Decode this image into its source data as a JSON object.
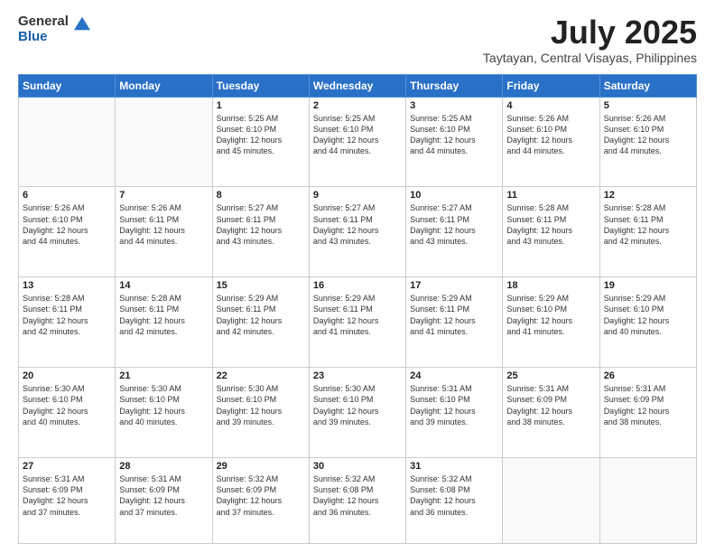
{
  "logo": {
    "general": "General",
    "blue": "Blue"
  },
  "header": {
    "month": "July 2025",
    "location": "Taytayan, Central Visayas, Philippines"
  },
  "weekdays": [
    "Sunday",
    "Monday",
    "Tuesday",
    "Wednesday",
    "Thursday",
    "Friday",
    "Saturday"
  ],
  "weeks": [
    [
      {
        "day": "",
        "info": ""
      },
      {
        "day": "",
        "info": ""
      },
      {
        "day": "1",
        "info": "Sunrise: 5:25 AM\nSunset: 6:10 PM\nDaylight: 12 hours\nand 45 minutes."
      },
      {
        "day": "2",
        "info": "Sunrise: 5:25 AM\nSunset: 6:10 PM\nDaylight: 12 hours\nand 44 minutes."
      },
      {
        "day": "3",
        "info": "Sunrise: 5:25 AM\nSunset: 6:10 PM\nDaylight: 12 hours\nand 44 minutes."
      },
      {
        "day": "4",
        "info": "Sunrise: 5:26 AM\nSunset: 6:10 PM\nDaylight: 12 hours\nand 44 minutes."
      },
      {
        "day": "5",
        "info": "Sunrise: 5:26 AM\nSunset: 6:10 PM\nDaylight: 12 hours\nand 44 minutes."
      }
    ],
    [
      {
        "day": "6",
        "info": "Sunrise: 5:26 AM\nSunset: 6:10 PM\nDaylight: 12 hours\nand 44 minutes."
      },
      {
        "day": "7",
        "info": "Sunrise: 5:26 AM\nSunset: 6:11 PM\nDaylight: 12 hours\nand 44 minutes."
      },
      {
        "day": "8",
        "info": "Sunrise: 5:27 AM\nSunset: 6:11 PM\nDaylight: 12 hours\nand 43 minutes."
      },
      {
        "day": "9",
        "info": "Sunrise: 5:27 AM\nSunset: 6:11 PM\nDaylight: 12 hours\nand 43 minutes."
      },
      {
        "day": "10",
        "info": "Sunrise: 5:27 AM\nSunset: 6:11 PM\nDaylight: 12 hours\nand 43 minutes."
      },
      {
        "day": "11",
        "info": "Sunrise: 5:28 AM\nSunset: 6:11 PM\nDaylight: 12 hours\nand 43 minutes."
      },
      {
        "day": "12",
        "info": "Sunrise: 5:28 AM\nSunset: 6:11 PM\nDaylight: 12 hours\nand 42 minutes."
      }
    ],
    [
      {
        "day": "13",
        "info": "Sunrise: 5:28 AM\nSunset: 6:11 PM\nDaylight: 12 hours\nand 42 minutes."
      },
      {
        "day": "14",
        "info": "Sunrise: 5:28 AM\nSunset: 6:11 PM\nDaylight: 12 hours\nand 42 minutes."
      },
      {
        "day": "15",
        "info": "Sunrise: 5:29 AM\nSunset: 6:11 PM\nDaylight: 12 hours\nand 42 minutes."
      },
      {
        "day": "16",
        "info": "Sunrise: 5:29 AM\nSunset: 6:11 PM\nDaylight: 12 hours\nand 41 minutes."
      },
      {
        "day": "17",
        "info": "Sunrise: 5:29 AM\nSunset: 6:11 PM\nDaylight: 12 hours\nand 41 minutes."
      },
      {
        "day": "18",
        "info": "Sunrise: 5:29 AM\nSunset: 6:10 PM\nDaylight: 12 hours\nand 41 minutes."
      },
      {
        "day": "19",
        "info": "Sunrise: 5:29 AM\nSunset: 6:10 PM\nDaylight: 12 hours\nand 40 minutes."
      }
    ],
    [
      {
        "day": "20",
        "info": "Sunrise: 5:30 AM\nSunset: 6:10 PM\nDaylight: 12 hours\nand 40 minutes."
      },
      {
        "day": "21",
        "info": "Sunrise: 5:30 AM\nSunset: 6:10 PM\nDaylight: 12 hours\nand 40 minutes."
      },
      {
        "day": "22",
        "info": "Sunrise: 5:30 AM\nSunset: 6:10 PM\nDaylight: 12 hours\nand 39 minutes."
      },
      {
        "day": "23",
        "info": "Sunrise: 5:30 AM\nSunset: 6:10 PM\nDaylight: 12 hours\nand 39 minutes."
      },
      {
        "day": "24",
        "info": "Sunrise: 5:31 AM\nSunset: 6:10 PM\nDaylight: 12 hours\nand 39 minutes."
      },
      {
        "day": "25",
        "info": "Sunrise: 5:31 AM\nSunset: 6:09 PM\nDaylight: 12 hours\nand 38 minutes."
      },
      {
        "day": "26",
        "info": "Sunrise: 5:31 AM\nSunset: 6:09 PM\nDaylight: 12 hours\nand 38 minutes."
      }
    ],
    [
      {
        "day": "27",
        "info": "Sunrise: 5:31 AM\nSunset: 6:09 PM\nDaylight: 12 hours\nand 37 minutes."
      },
      {
        "day": "28",
        "info": "Sunrise: 5:31 AM\nSunset: 6:09 PM\nDaylight: 12 hours\nand 37 minutes."
      },
      {
        "day": "29",
        "info": "Sunrise: 5:32 AM\nSunset: 6:09 PM\nDaylight: 12 hours\nand 37 minutes."
      },
      {
        "day": "30",
        "info": "Sunrise: 5:32 AM\nSunset: 6:08 PM\nDaylight: 12 hours\nand 36 minutes."
      },
      {
        "day": "31",
        "info": "Sunrise: 5:32 AM\nSunset: 6:08 PM\nDaylight: 12 hours\nand 36 minutes."
      },
      {
        "day": "",
        "info": ""
      },
      {
        "day": "",
        "info": ""
      }
    ]
  ]
}
